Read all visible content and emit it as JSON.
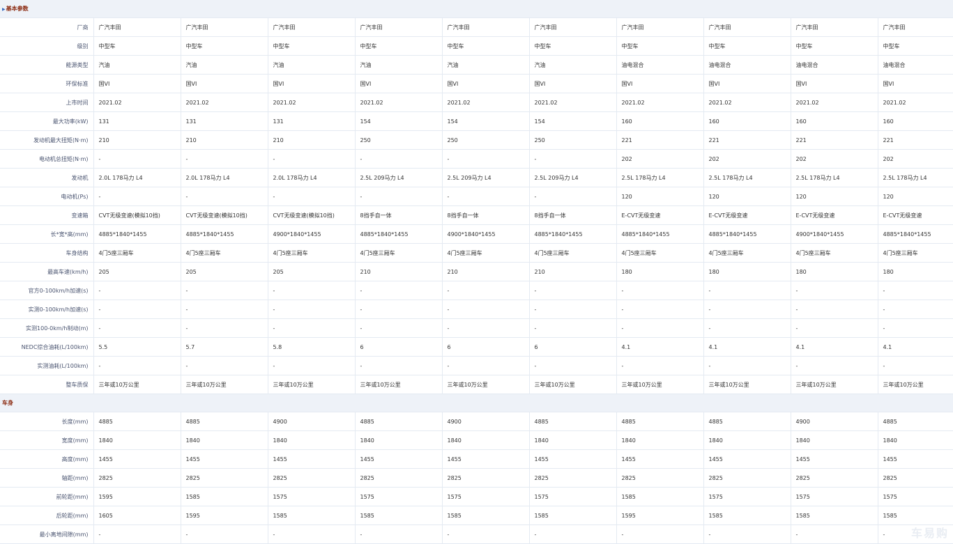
{
  "sections": {
    "basic": {
      "title": "基本参数",
      "rows": [
        {
          "label": "厂商",
          "values": [
            "广汽丰田",
            "广汽丰田",
            "广汽丰田",
            "广汽丰田",
            "广汽丰田",
            "广汽丰田",
            "广汽丰田",
            "广汽丰田",
            "广汽丰田",
            "广汽丰田"
          ]
        },
        {
          "label": "级别",
          "values": [
            "中型车",
            "中型车",
            "中型车",
            "中型车",
            "中型车",
            "中型车",
            "中型车",
            "中型车",
            "中型车",
            "中型车"
          ]
        },
        {
          "label": "能源类型",
          "values": [
            "汽油",
            "汽油",
            "汽油",
            "汽油",
            "汽油",
            "汽油",
            "油电混合",
            "油电混合",
            "油电混合",
            "油电混合"
          ]
        },
        {
          "label": "环保标准",
          "values": [
            "国VI",
            "国VI",
            "国VI",
            "国VI",
            "国VI",
            "国VI",
            "国VI",
            "国VI",
            "国VI",
            "国VI"
          ]
        },
        {
          "label": "上市时间",
          "values": [
            "2021.02",
            "2021.02",
            "2021.02",
            "2021.02",
            "2021.02",
            "2021.02",
            "2021.02",
            "2021.02",
            "2021.02",
            "2021.02"
          ]
        },
        {
          "label": "最大功率(kW)",
          "values": [
            "131",
            "131",
            "131",
            "154",
            "154",
            "154",
            "160",
            "160",
            "160",
            "160"
          ]
        },
        {
          "label": "发动机最大扭矩(N·m)",
          "values": [
            "210",
            "210",
            "210",
            "250",
            "250",
            "250",
            "221",
            "221",
            "221",
            "221"
          ]
        },
        {
          "label": "电动机总扭矩(N·m)",
          "values": [
            "-",
            "-",
            "-",
            "-",
            "-",
            "-",
            "202",
            "202",
            "202",
            "202"
          ]
        },
        {
          "label": "发动机",
          "values": [
            "2.0L 178马力 L4",
            "2.0L 178马力 L4",
            "2.0L 178马力 L4",
            "2.5L 209马力 L4",
            "2.5L 209马力 L4",
            "2.5L 209马力 L4",
            "2.5L 178马力 L4",
            "2.5L 178马力 L4",
            "2.5L 178马力 L4",
            "2.5L 178马力 L4"
          ]
        },
        {
          "label": "电动机(Ps)",
          "values": [
            "-",
            "-",
            "-",
            "-",
            "-",
            "-",
            "120",
            "120",
            "120",
            "120"
          ]
        },
        {
          "label": "变速箱",
          "values": [
            "CVT无级变速(模拟10挡)",
            "CVT无级变速(模拟10挡)",
            "CVT无级变速(模拟10挡)",
            "8挡手自一体",
            "8挡手自一体",
            "8挡手自一体",
            "E-CVT无级变速",
            "E-CVT无级变速",
            "E-CVT无级变速",
            "E-CVT无级变速"
          ]
        },
        {
          "label": "长*宽*高(mm)",
          "values": [
            "4885*1840*1455",
            "4885*1840*1455",
            "4900*1840*1455",
            "4885*1840*1455",
            "4900*1840*1455",
            "4885*1840*1455",
            "4885*1840*1455",
            "4885*1840*1455",
            "4900*1840*1455",
            "4885*1840*1455"
          ]
        },
        {
          "label": "车身结构",
          "values": [
            "4门5座三厢车",
            "4门5座三厢车",
            "4门5座三厢车",
            "4门5座三厢车",
            "4门5座三厢车",
            "4门5座三厢车",
            "4门5座三厢车",
            "4门5座三厢车",
            "4门5座三厢车",
            "4门5座三厢车"
          ]
        },
        {
          "label": "最高车速(km/h)",
          "values": [
            "205",
            "205",
            "205",
            "210",
            "210",
            "210",
            "180",
            "180",
            "180",
            "180"
          ]
        },
        {
          "label": "官方0-100km/h加速(s)",
          "values": [
            "-",
            "-",
            "-",
            "-",
            "-",
            "-",
            "-",
            "-",
            "-",
            "-"
          ]
        },
        {
          "label": "实测0-100km/h加速(s)",
          "values": [
            "-",
            "-",
            "-",
            "-",
            "-",
            "-",
            "-",
            "-",
            "-",
            "-"
          ]
        },
        {
          "label": "实测100-0km/h制动(m)",
          "values": [
            "-",
            "-",
            "-",
            "-",
            "-",
            "-",
            "-",
            "-",
            "-",
            "-"
          ]
        },
        {
          "label": "NEDC综合油耗(L/100km)",
          "values": [
            "5.5",
            "5.7",
            "5.8",
            "6",
            "6",
            "6",
            "4.1",
            "4.1",
            "4.1",
            "4.1"
          ]
        },
        {
          "label": "实测油耗(L/100km)",
          "values": [
            "-",
            "-",
            "-",
            "-",
            "-",
            "-",
            "-",
            "-",
            "-",
            "-"
          ]
        },
        {
          "label": "整车质保",
          "values": [
            "三年或10万公里",
            "三年或10万公里",
            "三年或10万公里",
            "三年或10万公里",
            "三年或10万公里",
            "三年或10万公里",
            "三年或10万公里",
            "三年或10万公里",
            "三年或10万公里",
            "三年或10万公里"
          ]
        }
      ]
    },
    "body": {
      "title": "车身",
      "rows": [
        {
          "label": "长度(mm)",
          "values": [
            "4885",
            "4885",
            "4900",
            "4885",
            "4900",
            "4885",
            "4885",
            "4885",
            "4900",
            "4885"
          ]
        },
        {
          "label": "宽度(mm)",
          "values": [
            "1840",
            "1840",
            "1840",
            "1840",
            "1840",
            "1840",
            "1840",
            "1840",
            "1840",
            "1840"
          ]
        },
        {
          "label": "高度(mm)",
          "values": [
            "1455",
            "1455",
            "1455",
            "1455",
            "1455",
            "1455",
            "1455",
            "1455",
            "1455",
            "1455"
          ]
        },
        {
          "label": "轴距(mm)",
          "values": [
            "2825",
            "2825",
            "2825",
            "2825",
            "2825",
            "2825",
            "2825",
            "2825",
            "2825",
            "2825"
          ]
        },
        {
          "label": "前轮距(mm)",
          "values": [
            "1595",
            "1585",
            "1575",
            "1575",
            "1575",
            "1575",
            "1585",
            "1575",
            "1575",
            "1575"
          ]
        },
        {
          "label": "后轮距(mm)",
          "values": [
            "1605",
            "1595",
            "1585",
            "1585",
            "1585",
            "1585",
            "1595",
            "1585",
            "1585",
            "1585"
          ]
        },
        {
          "label": "最小离地间隙(mm)",
          "values": [
            "-",
            "-",
            "-",
            "-",
            "-",
            "-",
            "-",
            "-",
            "-",
            "-"
          ]
        }
      ]
    }
  },
  "watermark": "车易购"
}
